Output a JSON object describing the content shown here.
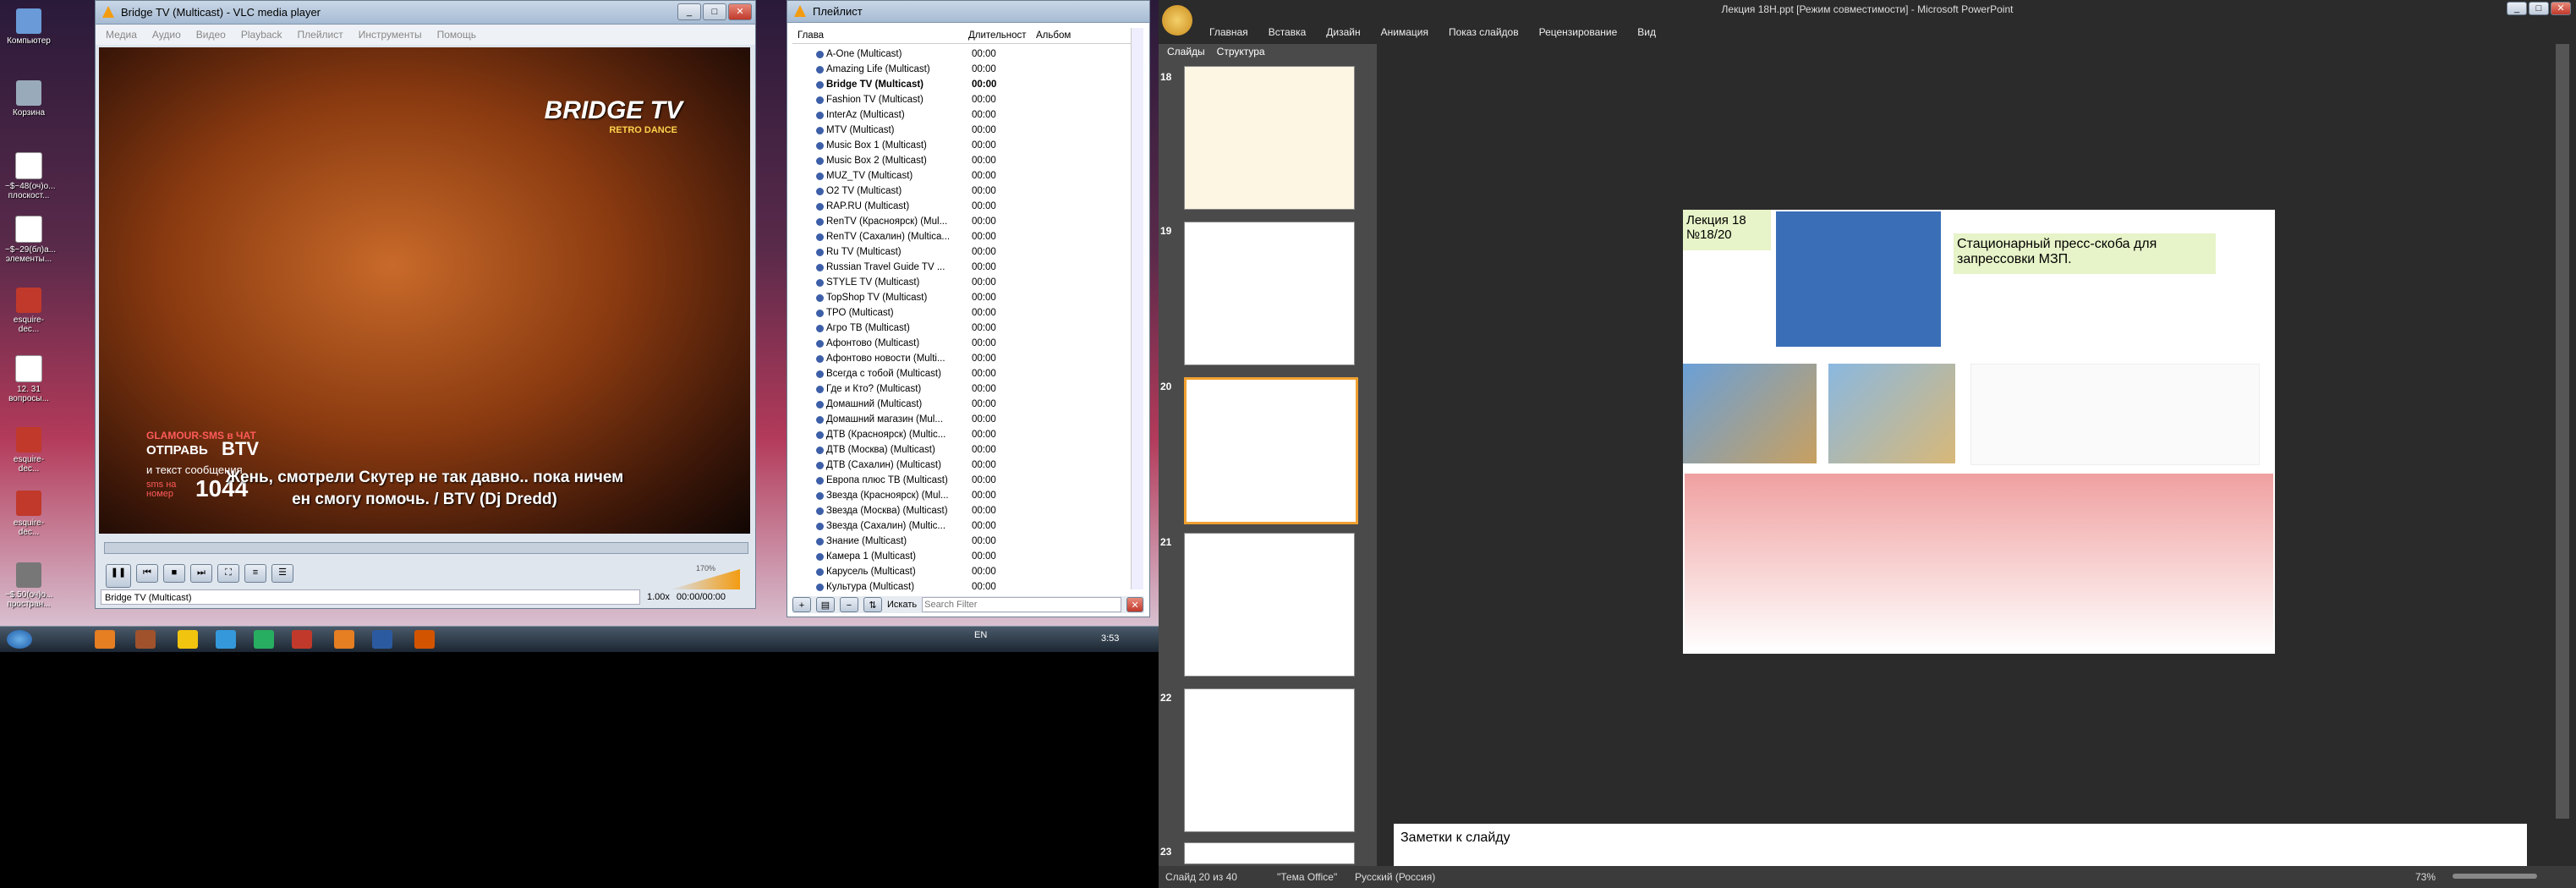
{
  "desktop": {
    "icons": [
      {
        "label": "Компьютер"
      },
      {
        "label": "Корзина"
      },
      {
        "label": "~$~48(оч)о... плоскост..."
      },
      {
        "label": "~$~29(бл)а... элементы..."
      },
      {
        "label": "esquire-dec..."
      },
      {
        "label": "12. 31 вопросы..."
      },
      {
        "label": "esquire-dec..."
      },
      {
        "label": "esquire-dec..."
      },
      {
        "label": "~$.50(оч)о... простран..."
      }
    ]
  },
  "taskbar": {
    "lang": "EN",
    "time": "3:53"
  },
  "vlc": {
    "title": "Bridge TV (Multicast) - VLC media player",
    "menu": [
      "Медиа",
      "Аудио",
      "Видео",
      "Playback",
      "Плейлист",
      "Инструменты",
      "Помощь"
    ],
    "channel_logo": "BRIDGE TV",
    "channel_sub": "RETRO DANCE",
    "promo_glamour": "GLAMOUR-SMS в ЧАТ",
    "promo_send": "ОТПРАВЬ",
    "promo_btv": "BTV",
    "promo_text": "и текст сообщения",
    "promo_sms": "sms на номер",
    "promo_number": "1044",
    "subtitle_1": "Жень, смотрели Скутер не так давно.. пока ничем",
    "subtitle_2": "ен смогу помочь. / BTV (Dj Dredd)",
    "status_name": "Bridge TV (Multicast)",
    "speed": "1.00x",
    "time": "00:00/00:00",
    "volume": "170%"
  },
  "playlist": {
    "title": "Плейлист",
    "columns": [
      "Глава",
      "Длительност",
      "Альбом"
    ],
    "items": [
      {
        "name": "A-One (Multicast)",
        "dur": "00:00"
      },
      {
        "name": "Amazing Life (Multicast)",
        "dur": "00:00"
      },
      {
        "name": "Bridge TV (Multicast)",
        "dur": "00:00"
      },
      {
        "name": "Fashion TV (Multicast)",
        "dur": "00:00"
      },
      {
        "name": "InterAz (Multicast)",
        "dur": "00:00"
      },
      {
        "name": "MTV (Multicast)",
        "dur": "00:00"
      },
      {
        "name": "Music Box 1 (Multicast)",
        "dur": "00:00"
      },
      {
        "name": "Music Box 2 (Multicast)",
        "dur": "00:00"
      },
      {
        "name": "MUZ_TV (Multicast)",
        "dur": "00:00"
      },
      {
        "name": "O2 TV (Multicast)",
        "dur": "00:00"
      },
      {
        "name": "RAP.RU (Multicast)",
        "dur": "00:00"
      },
      {
        "name": "RenTV (Красноярск) (Mul...",
        "dur": "00:00"
      },
      {
        "name": "RenTV (Сахалин) (Multica...",
        "dur": "00:00"
      },
      {
        "name": "Ru TV (Multicast)",
        "dur": "00:00"
      },
      {
        "name": "Russian Travel Guide TV ...",
        "dur": "00:00"
      },
      {
        "name": "STYLE TV (Multicast)",
        "dur": "00:00"
      },
      {
        "name": "TopShop TV (Multicast)",
        "dur": "00:00"
      },
      {
        "name": "ТРО (Multicast)",
        "dur": "00:00"
      },
      {
        "name": "Агро ТВ (Multicast)",
        "dur": "00:00"
      },
      {
        "name": "Афонтово (Multicast)",
        "dur": "00:00"
      },
      {
        "name": "Афонтово новости (Multi...",
        "dur": "00:00"
      },
      {
        "name": "Всегда с тобой (Multicast)",
        "dur": "00:00"
      },
      {
        "name": "Где и Кто? (Multicast)",
        "dur": "00:00"
      },
      {
        "name": "Домашний (Multicast)",
        "dur": "00:00"
      },
      {
        "name": "Домашний магазин (Mul...",
        "dur": "00:00"
      },
      {
        "name": "ДТВ (Красноярск) (Multic...",
        "dur": "00:00"
      },
      {
        "name": "ДТВ (Москва) (Multicast)",
        "dur": "00:00"
      },
      {
        "name": "ДТВ (Сахалин) (Multicast)",
        "dur": "00:00"
      },
      {
        "name": "Европа плюс ТВ (Multicast)",
        "dur": "00:00"
      },
      {
        "name": "Звезда (Красноярск) (Mul...",
        "dur": "00:00"
      },
      {
        "name": "Звезда (Москва) (Multicast)",
        "dur": "00:00"
      },
      {
        "name": "Звезда (Сахалин) (Multic...",
        "dur": "00:00"
      },
      {
        "name": "Знание (Multicast)",
        "dur": "00:00"
      },
      {
        "name": "Камера 1 (Multicast)",
        "dur": "00:00"
      },
      {
        "name": "Карусель (Multicast)",
        "dur": "00:00"
      },
      {
        "name": "Культура (Multicast)",
        "dur": "00:00"
      }
    ],
    "search_label": "Искать",
    "search_placeholder": "Search Filter"
  },
  "ppt": {
    "title": "Лекция 18Н.ppt [Режим совместимости] - Microsoft PowerPoint",
    "tabs": [
      "Главная",
      "Вставка",
      "Дизайн",
      "Анимация",
      "Показ слайдов",
      "Рецензирование",
      "Вид"
    ],
    "panel_tabs": [
      "Слайды",
      "Структура"
    ],
    "thumb_numbers": [
      "18",
      "19",
      "20",
      "21",
      "22",
      "23"
    ],
    "slide_label_1": "Лекция 18",
    "slide_label_2": "№18/20",
    "slide_heading": "Стационарный пресс-скоба для запрессовки МЗП.",
    "notes_placeholder": "Заметки к слайду",
    "status_slide": "Слайд 20 из 40",
    "status_theme": "\"Тема Office\"",
    "status_lang": "Русский (Россия)",
    "zoom": "73%"
  }
}
